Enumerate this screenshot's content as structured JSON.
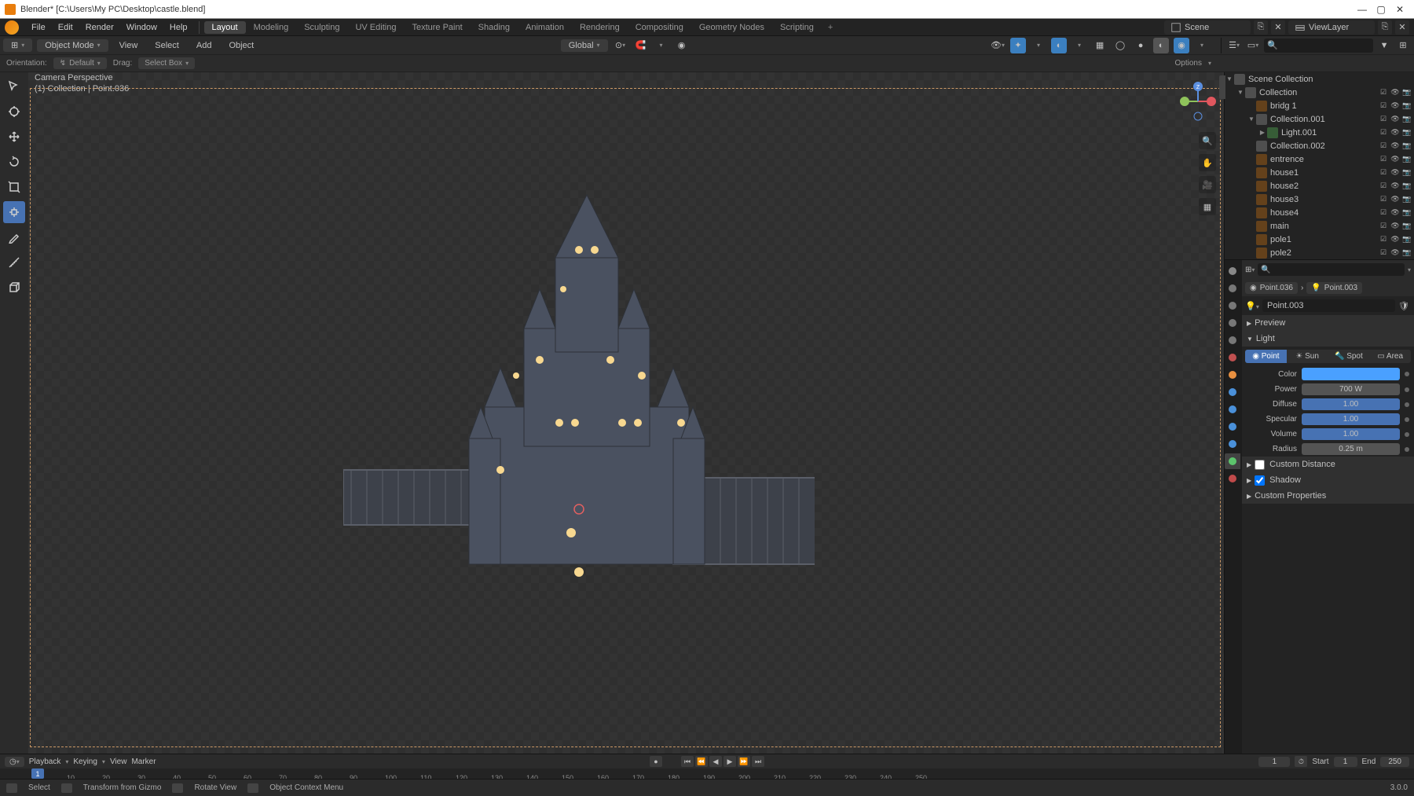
{
  "title": "Blender* [C:\\Users\\My PC\\Desktop\\castle.blend]",
  "topmenu": [
    "File",
    "Edit",
    "Render",
    "Window",
    "Help"
  ],
  "workspaces": [
    "Layout",
    "Modeling",
    "Sculpting",
    "UV Editing",
    "Texture Paint",
    "Shading",
    "Animation",
    "Rendering",
    "Compositing",
    "Geometry Nodes",
    "Scripting"
  ],
  "scene": "Scene",
  "viewlayer": "ViewLayer",
  "mode": "Object Mode",
  "view_menus": [
    "View",
    "Select",
    "Add",
    "Object"
  ],
  "orientation_lbl": "Orientation:",
  "orientation_val": "Default",
  "drag_lbl": "Drag:",
  "drag_val": "Select Box",
  "transform": "Global",
  "options_lbl": "Options",
  "overlay": {
    "line1": "Camera Perspective",
    "line2": "(1) Collection | Point.036"
  },
  "outliner": {
    "root": "Scene Collection",
    "items": [
      {
        "name": "Collection",
        "type": "col",
        "depth": 0,
        "expand": "▼"
      },
      {
        "name": "bridg 1",
        "type": "mesh",
        "depth": 1
      },
      {
        "name": "Collection.001",
        "type": "col",
        "depth": 1,
        "expand": "▼"
      },
      {
        "name": "Light.001",
        "type": "light",
        "depth": 2,
        "expand": "▶"
      },
      {
        "name": "Collection.002",
        "type": "col",
        "depth": 1
      },
      {
        "name": "entrence",
        "type": "mesh",
        "depth": 1
      },
      {
        "name": "house1",
        "type": "mesh",
        "depth": 1
      },
      {
        "name": "house2",
        "type": "mesh",
        "depth": 1
      },
      {
        "name": "house3",
        "type": "mesh",
        "depth": 1
      },
      {
        "name": "house4",
        "type": "mesh",
        "depth": 1
      },
      {
        "name": "main",
        "type": "mesh",
        "depth": 1
      },
      {
        "name": "pole1",
        "type": "mesh",
        "depth": 1
      },
      {
        "name": "pole2",
        "type": "mesh",
        "depth": 1
      }
    ]
  },
  "props": {
    "crumb1": "Point.036",
    "crumb2": "Point.003",
    "data_name": "Point.003",
    "preview": "Preview",
    "light_panel": "Light",
    "types": [
      "Point",
      "Sun",
      "Spot",
      "Area"
    ],
    "color_lbl": "Color",
    "power_lbl": "Power",
    "power": "700 W",
    "diffuse_lbl": "Diffuse",
    "diffuse": "1.00",
    "specular_lbl": "Specular",
    "specular": "1.00",
    "volume_lbl": "Volume",
    "volume": "1.00",
    "radius_lbl": "Radius",
    "radius": "0.25 m",
    "custom_dist": "Custom Distance",
    "shadow": "Shadow",
    "custom_props": "Custom Properties"
  },
  "timeline": {
    "menus": [
      "Playback",
      "Keying",
      "View",
      "Marker"
    ],
    "current": "1",
    "start_lbl": "Start",
    "start": "1",
    "end_lbl": "End",
    "end": "250",
    "ticks": [
      10,
      30,
      50,
      70,
      90,
      110,
      130,
      150,
      170,
      190,
      210,
      230,
      250
    ],
    "ticks_minor": [
      20,
      40,
      60,
      80,
      100,
      120,
      140,
      160,
      180,
      200,
      220,
      240
    ]
  },
  "status": {
    "select": "Select",
    "transform": "Transform from Gizmo",
    "rotate": "Rotate View",
    "context": "Object Context Menu",
    "version": "3.0.0"
  }
}
